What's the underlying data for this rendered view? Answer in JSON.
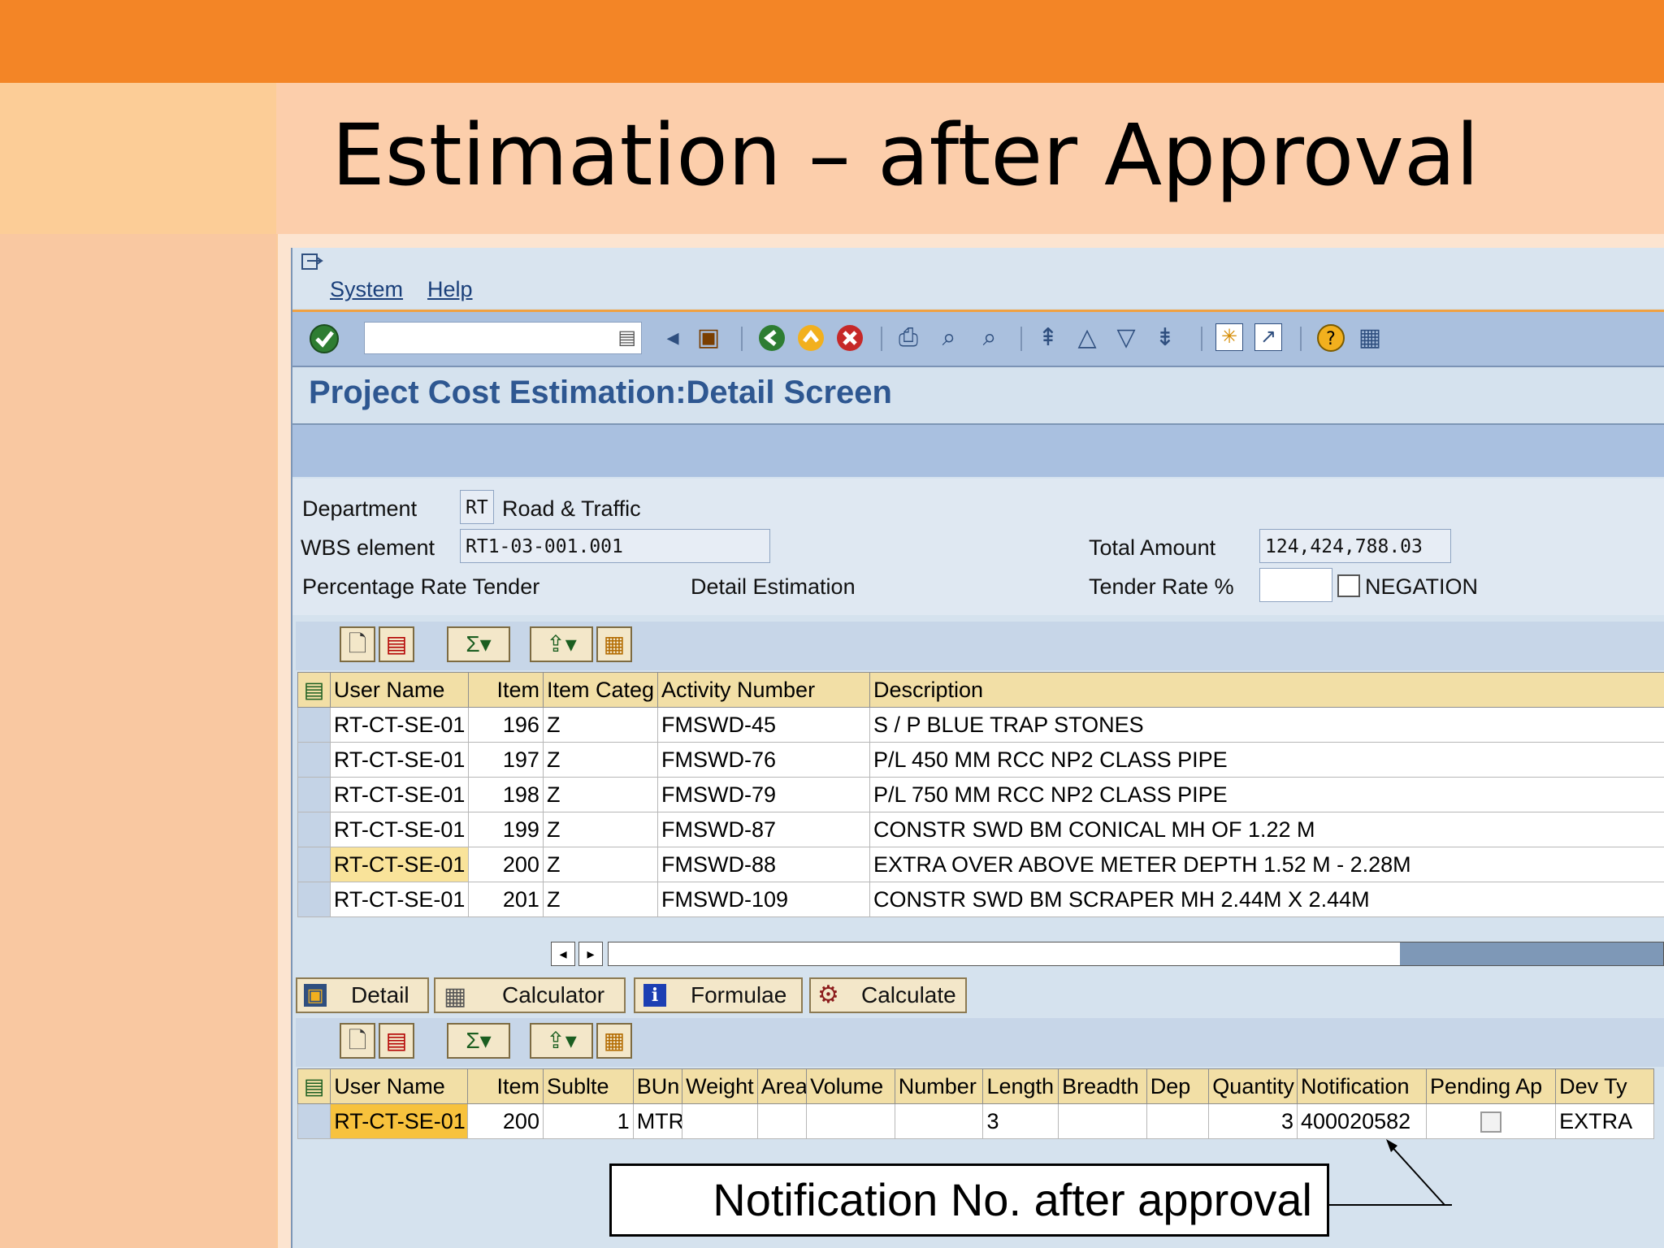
{
  "slide": {
    "title": "Estimation – after Approval"
  },
  "menu": {
    "items": [
      "System",
      "Help"
    ]
  },
  "screen": {
    "title": "Project Cost Estimation:Detail Screen"
  },
  "form": {
    "department_label": "Department",
    "department_code": "RT",
    "department_name": "Road & Traffic",
    "wbs_label": "WBS element",
    "wbs_value": "RT1-03-001.001",
    "pct_label": "Percentage Rate Tender",
    "detail_label": "Detail Estimation",
    "total_label": "Total Amount",
    "total_value": "124,424,788.03",
    "tender_label": "Tender Rate %",
    "tender_value": "",
    "negation_label": "NEGATION"
  },
  "upper_grid": {
    "headers": [
      "User Name",
      "Item",
      "Item Categ",
      "Activity Number",
      "Description"
    ],
    "rows": [
      [
        "RT-CT-SE-01",
        "196",
        "Z",
        "FMSWD-45",
        "S / P BLUE TRAP STONES"
      ],
      [
        "RT-CT-SE-01",
        "197",
        "Z",
        "FMSWD-76",
        "P/L 450 MM RCC NP2 CLASS PIPE"
      ],
      [
        "RT-CT-SE-01",
        "198",
        "Z",
        "FMSWD-79",
        "P/L 750 MM RCC NP2 CLASS PIPE"
      ],
      [
        "RT-CT-SE-01",
        "199",
        "Z",
        "FMSWD-87",
        "CONSTR SWD BM CONICAL MH OF 1.22 M"
      ],
      [
        "RT-CT-SE-01",
        "200",
        "Z",
        "FMSWD-88",
        "EXTRA OVER ABOVE METER DEPTH 1.52 M - 2.28M"
      ],
      [
        "RT-CT-SE-01",
        "201",
        "Z",
        "FMSWD-109",
        "CONSTR SWD BM SCRAPER MH 2.44M X 2.44M"
      ]
    ]
  },
  "actions": {
    "detail": "Detail",
    "calculator": "Calculator",
    "formulae": "Formulae",
    "calculate": "Calculate"
  },
  "lower_grid": {
    "headers": [
      "User Name",
      "Item",
      "Sublte",
      "BUn",
      "Weight",
      "Area",
      "Volume",
      "Number",
      "Length",
      "Breadth",
      "Dep",
      "Quantity",
      "Notification",
      "Pending Ap",
      "Dev Ty"
    ],
    "row": [
      "RT-CT-SE-01",
      "200",
      "1",
      "MTR",
      "",
      "",
      "",
      "",
      "3",
      "",
      "",
      "3",
      "400020582",
      "",
      "EXTRA"
    ]
  },
  "callout": {
    "text": "Notification No. after approval"
  },
  "colors": {
    "slide_bar": "#f38526",
    "title_bg": "#fcceab",
    "header_gold": "#f2dfa6",
    "sap_blue": "#a9c0e0"
  }
}
